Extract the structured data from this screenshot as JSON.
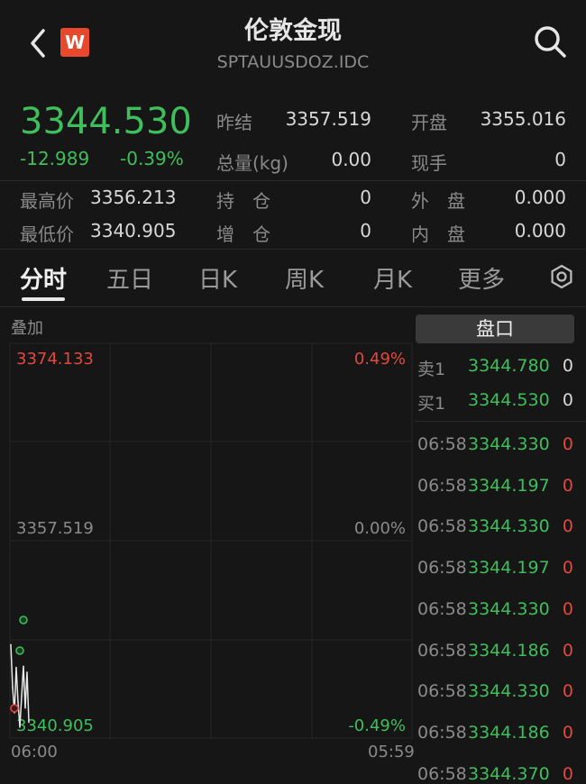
{
  "header": {
    "title": "伦敦金现",
    "subtitle": "SPTAUUSDOZ.IDC",
    "logo_text": "W"
  },
  "quote": {
    "price": "3344.530",
    "change": "-12.989",
    "change_pct": "-0.39%",
    "stats": [
      {
        "label": "昨结",
        "value": "3357.519"
      },
      {
        "label": "开盘",
        "value": "3355.016"
      },
      {
        "label": "总量(kg)",
        "value": "0.00"
      },
      {
        "label": "现手",
        "value": "0"
      },
      {
        "label": "最高价",
        "value": "3356.213"
      },
      {
        "label": "持　仓",
        "value": "0"
      },
      {
        "label": "外　盘",
        "value": "0.000"
      },
      {
        "label": "最低价",
        "value": "3340.905"
      },
      {
        "label": "增　仓",
        "value": "0"
      },
      {
        "label": "内　盘",
        "value": "0.000"
      }
    ]
  },
  "tabs": [
    "分时",
    "五日",
    "日K",
    "周K",
    "月K",
    "更多"
  ],
  "chart": {
    "overlay_label": "叠加",
    "y_top": "3374.133",
    "y_mid": "3357.519",
    "y_bottom": "3340.905",
    "pct_top": "0.49%",
    "pct_mid": "0.00%",
    "pct_bottom": "-0.49%",
    "time_start": "06:00",
    "time_end": "05:59"
  },
  "chart_data": {
    "type": "line",
    "ylim": [
      3340.905,
      3374.133
    ],
    "y_ticks": [
      "3374.133",
      "3357.519",
      "3340.905"
    ],
    "x_ticks": [
      "06:00",
      "05:59"
    ],
    "series": [
      {
        "values": [
          3348.8,
          3345.2,
          3343.1,
          3346.9,
          3344.0,
          3341.9,
          3344.5,
          3347.0,
          3343.5,
          3346.5,
          3342.3
        ]
      }
    ]
  },
  "order_book": {
    "button_label": "盘口",
    "asks": [
      {
        "label": "卖1",
        "price": "3344.780",
        "vol": "0"
      }
    ],
    "bids": [
      {
        "label": "买1",
        "price": "3344.530",
        "vol": "0"
      }
    ],
    "ticks": [
      {
        "time": "06:58",
        "price": "3344.330",
        "vol": "0"
      },
      {
        "time": "06:58",
        "price": "3344.197",
        "vol": "0"
      },
      {
        "time": "06:58",
        "price": "3344.330",
        "vol": "0"
      },
      {
        "time": "06:58",
        "price": "3344.197",
        "vol": "0"
      },
      {
        "time": "06:58",
        "price": "3344.330",
        "vol": "0"
      },
      {
        "time": "06:58",
        "price": "3344.186",
        "vol": "0"
      },
      {
        "time": "06:58",
        "price": "3344.330",
        "vol": "0"
      },
      {
        "time": "06:58",
        "price": "3344.186",
        "vol": "0"
      },
      {
        "time": "06:58",
        "price": "3344.370",
        "vol": "0"
      }
    ]
  },
  "colors": {
    "up": "#e2483d",
    "down": "#3fbf5b",
    "background": "#161616"
  }
}
